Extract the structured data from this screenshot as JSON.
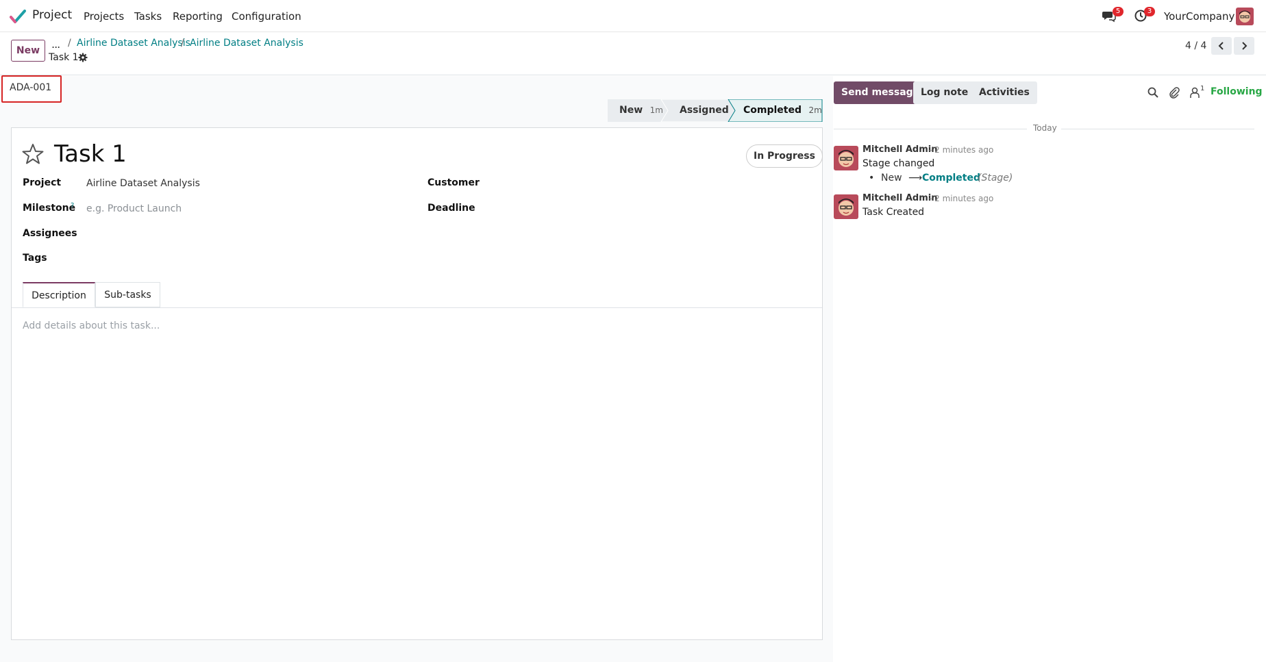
{
  "topnav": {
    "app_name": "Project",
    "menu": [
      "Projects",
      "Tasks",
      "Reporting",
      "Configuration"
    ],
    "messages_badge": "5",
    "activities_badge": "3",
    "company": "YourCompany"
  },
  "control_panel": {
    "new_label": "New",
    "more": "...",
    "breadcrumbs": [
      "Airline Dataset Analysis",
      "Airline Dataset Analysis"
    ],
    "record_name": "Task 1",
    "pager": "4 / 4"
  },
  "form": {
    "reference": "ADA-001",
    "stages": [
      {
        "label": "New",
        "time": "1m"
      },
      {
        "label": "Assigned",
        "time": ""
      },
      {
        "label": "Completed",
        "time": "2m"
      }
    ],
    "title": "Task 1",
    "state": "In Progress",
    "fields": {
      "project_label": "Project",
      "project_value": "Airline Dataset Analysis",
      "milestone_label": "Milestone",
      "milestone_help": "?",
      "milestone_placeholder": "e.g. Product Launch",
      "assignees_label": "Assignees",
      "tags_label": "Tags",
      "customer_label": "Customer",
      "deadline_label": "Deadline"
    },
    "tabs": [
      "Description",
      "Sub-tasks"
    ],
    "description_placeholder": "Add details about this task..."
  },
  "chatter": {
    "send_message": "Send message",
    "log_note": "Log note",
    "activities": "Activities",
    "followers_count": "1",
    "following": "Following",
    "date_separator": "Today",
    "messages": [
      {
        "author": "Mitchell Admin",
        "time": "- 2 minutes ago",
        "body": "Stage changed",
        "tracking_old": "New",
        "tracking_arrow": "⟶",
        "tracking_new": "Completed",
        "tracking_field": "(Stage)"
      },
      {
        "author": "Mitchell Admin",
        "time": "- 2 minutes ago",
        "body": "Task Created"
      }
    ]
  },
  "colors": {
    "brand": "#714b67",
    "link": "#017e84",
    "accent_green": "#28a745",
    "badge": "#e0262c"
  }
}
